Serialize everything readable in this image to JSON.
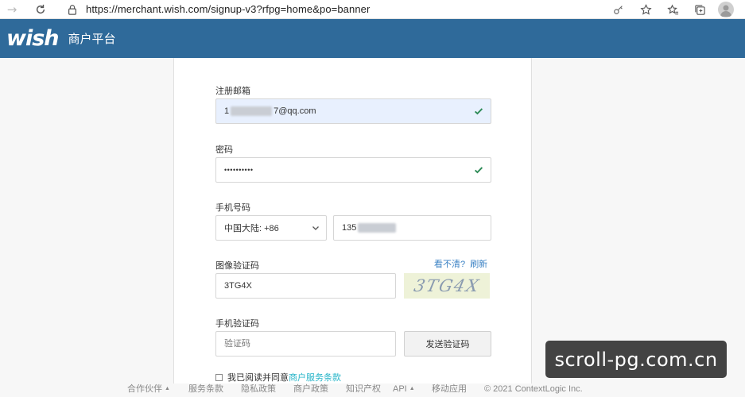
{
  "browser": {
    "url": "https://merchant.wish.com/signup-v3?rfpg=home&po=banner"
  },
  "header": {
    "logo": "wish",
    "platform_title": "商户平台",
    "color": "#2f6a9a"
  },
  "form": {
    "email": {
      "label": "注册邮箱",
      "value_visible_prefix": "1",
      "value_visible_suffix": "7@qq.com"
    },
    "password": {
      "label": "密码",
      "value": "••••••••••"
    },
    "phone": {
      "label": "手机号码",
      "country": "中国大陆: +86",
      "number_visible_prefix": "135"
    },
    "image_captcha": {
      "label": "图像验证码",
      "value": "3TG4X",
      "cant_see_link": "看不清?",
      "refresh_link": "刷新",
      "captcha_text": "3TG4X"
    },
    "sms_code": {
      "label": "手机验证码",
      "placeholder": "验证码",
      "send_button": "发送验证码"
    },
    "agreement": {
      "prefix": "我已阅读并同意",
      "link": "商户服务条款"
    }
  },
  "footer": {
    "items": [
      "合作伙伴",
      "服务条款",
      "隐私政策",
      "商户政策",
      "知识产权",
      "API",
      "移动应用",
      "© 2021 ContextLogic Inc."
    ]
  },
  "watermark": {
    "text": "scroll-pg.com.cn"
  }
}
